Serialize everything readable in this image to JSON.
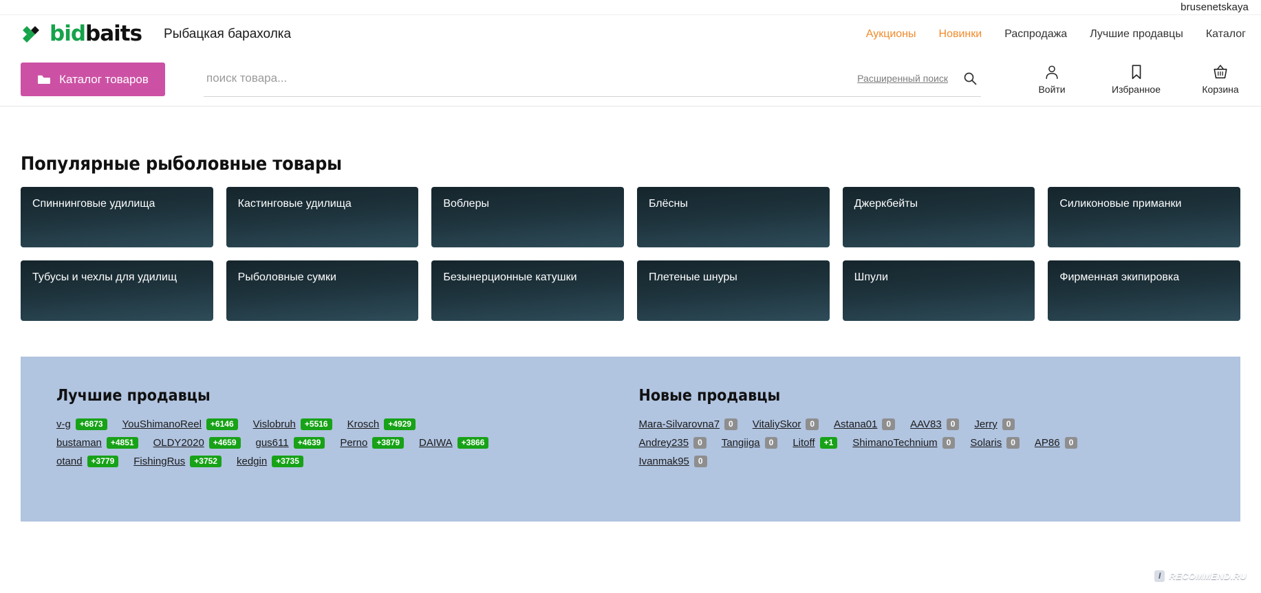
{
  "topbar": {
    "username": "brusenetskaya"
  },
  "brand": {
    "logo_bid": "bid",
    "logo_baits": "baits",
    "tagline": "Рыбацкая барахолка",
    "logo_icon": "bidbaits-diamond-logo"
  },
  "nav": {
    "items": [
      {
        "label": "Аукционы",
        "accent": true
      },
      {
        "label": "Новинки",
        "accent": true
      },
      {
        "label": "Распродажа",
        "accent": false
      },
      {
        "label": "Лучшие продавцы",
        "accent": false
      },
      {
        "label": "Каталог",
        "accent": false
      }
    ]
  },
  "tools": {
    "catalog_button": "Каталог товаров",
    "catalog_icon": "folder-icon",
    "search_placeholder": "поиск товара...",
    "search_value": "",
    "advanced_search": "Расширенный поиск",
    "search_icon": "search-icon",
    "actions": [
      {
        "label": "Войти",
        "icon": "user-icon"
      },
      {
        "label": "Избранное",
        "icon": "bookmark-icon"
      },
      {
        "label": "Корзина",
        "icon": "basket-icon"
      }
    ]
  },
  "popular": {
    "title": "Популярные рыболовные товары",
    "row1": [
      "Спиннинговые удилища",
      "Кастинговые удилища",
      "Воблеры",
      "Блёсны",
      "Джеркбейты",
      "Силиконовые приманки"
    ],
    "row2": [
      "Тубусы и чехлы для удилищ",
      "Рыболовные сумки",
      "Безынерционные катушки",
      "Плетеные шнуры",
      "Шпули",
      "Фирменная экипировка"
    ]
  },
  "sellers": {
    "top": {
      "title": "Лучшие продавцы",
      "items": [
        {
          "name": "v-g",
          "rating": "+6873",
          "positive": true
        },
        {
          "name": "YouShimanoReel",
          "rating": "+6146",
          "positive": true
        },
        {
          "name": "Vislobruh",
          "rating": "+5516",
          "positive": true
        },
        {
          "name": "Krosch",
          "rating": "+4929",
          "positive": true
        },
        {
          "name": "bustaman",
          "rating": "+4851",
          "positive": true
        },
        {
          "name": "OLDY2020",
          "rating": "+4659",
          "positive": true
        },
        {
          "name": "gus611",
          "rating": "+4639",
          "positive": true
        },
        {
          "name": "Perno",
          "rating": "+3879",
          "positive": true
        },
        {
          "name": "DAIWA",
          "rating": "+3866",
          "positive": true
        },
        {
          "name": "otand",
          "rating": "+3779",
          "positive": true
        },
        {
          "name": "FishingRus",
          "rating": "+3752",
          "positive": true
        },
        {
          "name": "kedgin",
          "rating": "+3735",
          "positive": true
        }
      ]
    },
    "new": {
      "title": "Новые продавцы",
      "items": [
        {
          "name": "Mara-Silvarovna7",
          "rating": "0",
          "positive": false
        },
        {
          "name": "VitaliySkor",
          "rating": "0",
          "positive": false
        },
        {
          "name": "Astana01",
          "rating": "0",
          "positive": false
        },
        {
          "name": "AAV83",
          "rating": "0",
          "positive": false
        },
        {
          "name": "Jerry",
          "rating": "0",
          "positive": false
        },
        {
          "name": "Andrey235",
          "rating": "0",
          "positive": false
        },
        {
          "name": "Tangiiga",
          "rating": "0",
          "positive": false
        },
        {
          "name": "Litoff",
          "rating": "+1",
          "positive": true
        },
        {
          "name": "ShimanoTechnium",
          "rating": "0",
          "positive": false
        },
        {
          "name": "Solaris",
          "rating": "0",
          "positive": false
        },
        {
          "name": "AP86",
          "rating": "0",
          "positive": false
        },
        {
          "name": "Ivanmak95",
          "rating": "0",
          "positive": false
        }
      ]
    }
  },
  "watermark": {
    "badge": "I",
    "text": "RECOMMEND.RU"
  },
  "colors": {
    "accent_orange": "#f08b2c",
    "catalog_pink": "#cc51a4",
    "logo_green": "#16a34a",
    "tile_dark": "#16252c",
    "tile_light": "#2e4c59",
    "panel_blue": "#b1c4e0",
    "badge_green": "#17a217",
    "badge_gray": "#8e8e8e"
  }
}
